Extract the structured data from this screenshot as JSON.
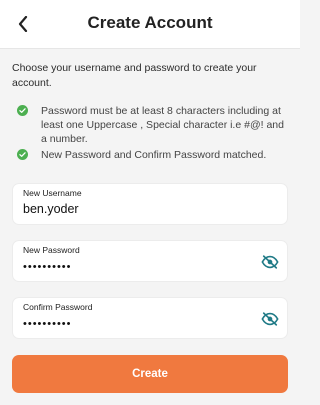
{
  "header": {
    "title": "Create Account",
    "back_icon": "chevron-left-icon"
  },
  "intro": "Choose your username and password to create your account.",
  "rules": [
    {
      "text": "Password must be at least 8 characters including at least one Uppercase , Special character i.e #@! and a number.",
      "icon": "check-circle-icon"
    },
    {
      "text": "New Password and Confirm Password matched.",
      "icon": "check-circle-icon"
    }
  ],
  "form": {
    "username": {
      "label": "New Username",
      "value": "ben.yoder"
    },
    "new_password": {
      "label": "New Password",
      "value": "••••••••••",
      "icon": "eye-off-icon"
    },
    "confirm_password": {
      "label": "Confirm Password",
      "value": "••••••••••",
      "icon": "eye-off-icon"
    }
  },
  "create_label": "Create",
  "colors": {
    "accent": "#f0793f",
    "check": "#4caf50",
    "eye": "#1f7a86"
  }
}
